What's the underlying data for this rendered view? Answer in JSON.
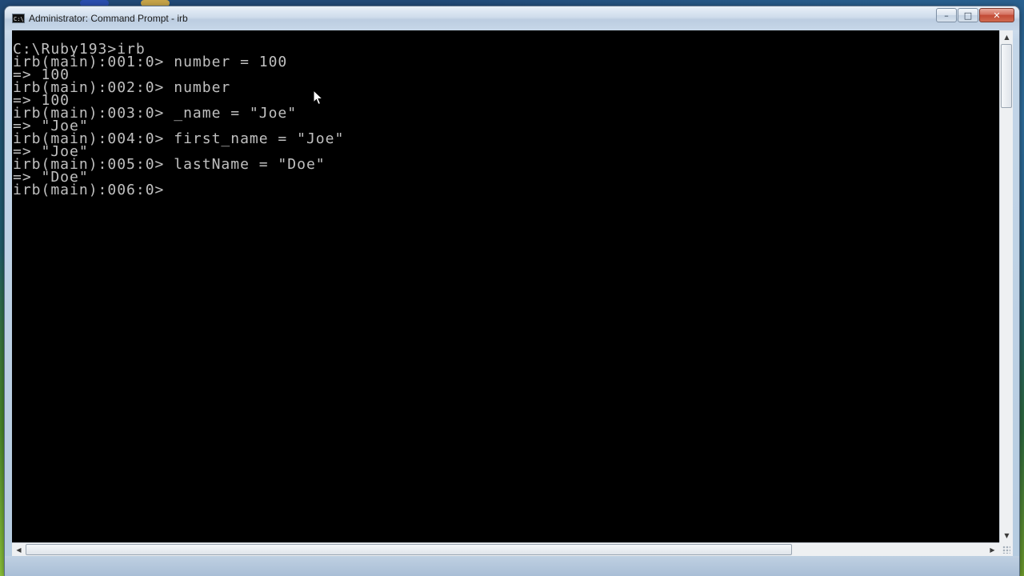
{
  "window": {
    "title": "Administrator: Command Prompt - irb",
    "icon": "cmd-icon",
    "icon_text": "C:\\",
    "buttons": {
      "minimize_label": "–",
      "maximize_label": "□",
      "close_label": "✕"
    }
  },
  "console": {
    "lines": [
      "C:\\Ruby193>irb",
      "irb(main):001:0> number = 100",
      "=> 100",
      "irb(main):002:0> number",
      "=> 100",
      "irb(main):003:0> _name = \"Joe\"",
      "=> \"Joe\"",
      "irb(main):004:0> first_name = \"Joe\"",
      "=> \"Joe\"",
      "irb(main):005:0> lastName = \"Doe\"",
      "=> \"Doe\"",
      "irb(main):006:0>"
    ]
  },
  "scrollbars": {
    "up_arrow": "▲",
    "down_arrow": "▼",
    "left_arrow": "◀",
    "right_arrow": "▶"
  },
  "colors": {
    "console_bg": "#000000",
    "console_fg": "#c0c0c0",
    "titlebar": "#c7d7e8",
    "close_button": "#c24a35"
  }
}
